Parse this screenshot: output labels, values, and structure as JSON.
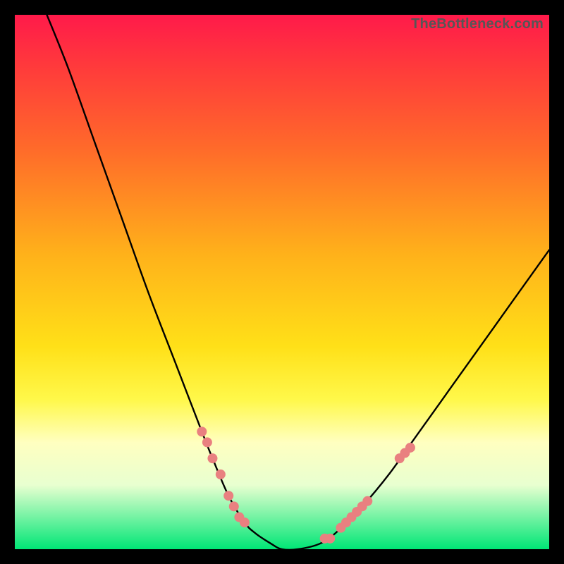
{
  "attribution": "TheBottleneck.com",
  "chart_data": {
    "type": "line",
    "title": "",
    "xlabel": "",
    "ylabel": "",
    "xlim": [
      0,
      100
    ],
    "ylim": [
      0,
      100
    ],
    "curve": {
      "name": "bottleneck-curve",
      "x": [
        6,
        10,
        15,
        20,
        25,
        30,
        35,
        37,
        40,
        43,
        45,
        48,
        50,
        53,
        57,
        60,
        65,
        70,
        75,
        80,
        85,
        90,
        95,
        100
      ],
      "y": [
        100,
        90,
        76,
        62,
        48,
        35,
        22,
        17,
        10,
        5,
        3,
        1,
        0,
        0,
        1,
        3,
        8,
        14,
        21,
        28,
        35,
        42,
        49,
        56
      ]
    },
    "markers": {
      "name": "highlight-points",
      "x": [
        35,
        36,
        37,
        38.5,
        40,
        41,
        42,
        43,
        58,
        59,
        61,
        62,
        63,
        64,
        65,
        66,
        72,
        73,
        74
      ],
      "y": [
        22,
        20,
        17,
        14,
        10,
        8,
        6,
        5,
        2,
        2,
        4,
        5,
        6,
        7,
        8,
        9,
        17,
        18,
        19
      ],
      "color": "#e98080",
      "radius_px": 7
    }
  }
}
